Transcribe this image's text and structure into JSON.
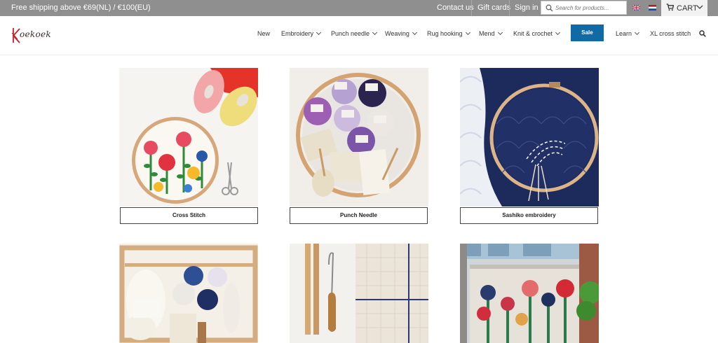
{
  "topbar": {
    "shipping": "Free shipping above €69(NL) / €100(EU)",
    "contact": "Contact us",
    "gift_cards": "Gift cards",
    "sign_in": "Sign in",
    "search_placeholder": "Search for products...",
    "cart_label": "CART"
  },
  "header": {
    "logo_text": "oekoek",
    "nav": {
      "new": "New",
      "embroidery": "Embroidery",
      "punch_needle": "Punch needle",
      "weaving": "Weaving",
      "rug_hooking": "Rug hooking",
      "mend": "Mend",
      "knit_crochet": "Knit & crochet",
      "sale": "Sale",
      "learn": "Learn",
      "xl_cross_stitch": "XL cross stitch"
    }
  },
  "categories": [
    {
      "label": "Cross Stitch"
    },
    {
      "label": "Punch Needle"
    },
    {
      "label": "Sashiko embroidery"
    }
  ],
  "colors": {
    "topbar_bg": "#8f8f8f",
    "sale_bg": "#0f6aa6",
    "brand_red": "#c8202e"
  }
}
